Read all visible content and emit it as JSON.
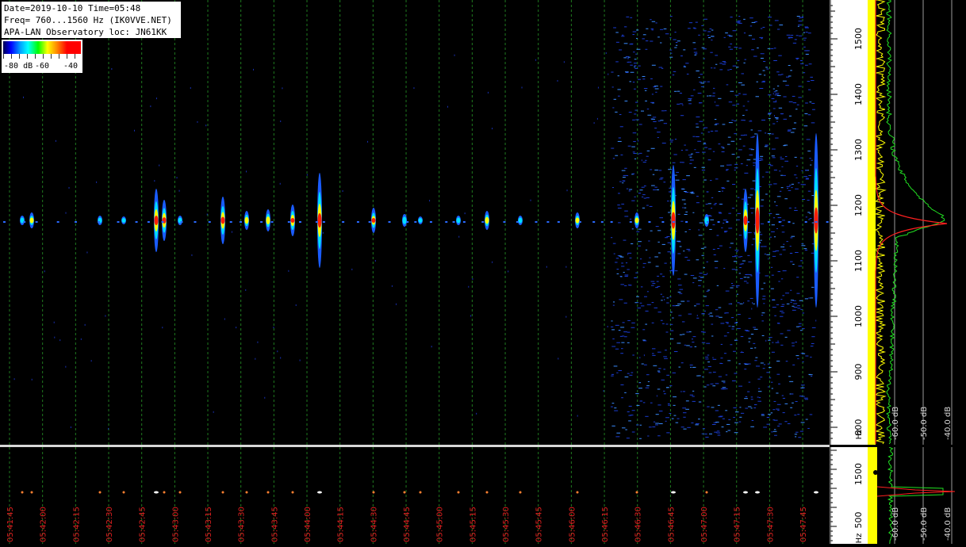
{
  "info": {
    "line1": "Date=2019-10-10 Time=05:48",
    "line2": "Freq= 760...1560 Hz (IK0VVE.NET)",
    "line3": "APA-LAN Observatory loc: JN61KK"
  },
  "legend": {
    "labels": [
      "-80 dB",
      "-60",
      "-40"
    ]
  },
  "freq_axis": {
    "labels": [
      "1500",
      "1400",
      "1300",
      "1200",
      "1100",
      "1000",
      "900",
      "800"
    ],
    "unit": "Hz"
  },
  "mini_axis": {
    "labels": [
      "1500",
      "500"
    ],
    "unit": "Hz"
  },
  "spectrum_db_labels": [
    "-60.0 dB",
    "-50.0 dB",
    "-40.0 dB"
  ],
  "time_labels": [
    "05:41:45",
    "05:42:00",
    "05:42:15",
    "05:42:30",
    "05:42:45",
    "05:43:00",
    "05:43:15",
    "05:43:30",
    "05:43:45",
    "05:44:00",
    "05:44:15",
    "05:44:30",
    "05:44:45",
    "05:45:00",
    "05:45:15",
    "05:45:30",
    "05:45:45",
    "05:46:00",
    "05:46:15",
    "05:46:30",
    "05:46:45",
    "05:47:00",
    "05:47:15",
    "05:47:30",
    "05:47:45"
  ],
  "colors": {
    "grid": "#1f7a1f",
    "time_text": "#e02020",
    "yellow": "#ffff00",
    "green": "#22e022",
    "red": "#ff2020"
  }
}
